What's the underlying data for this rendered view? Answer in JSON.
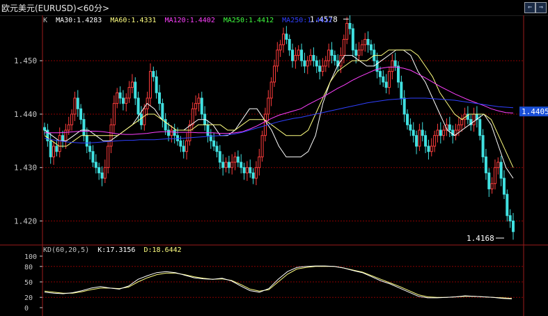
{
  "window": {
    "title": "欧元美元(EURUSD)<60分>",
    "nav": {
      "prev": "⇐",
      "next": "⇒"
    }
  },
  "main_panel": {
    "legend_prefix": "K",
    "ma": [
      {
        "label": "MA30:1.4283",
        "color": "#ffffff"
      },
      {
        "label": "MA60:1.4331",
        "color": "#ffff80"
      },
      {
        "label": "MA120:1.4402",
        "color": "#ff40ff"
      },
      {
        "label": "MA250:1.4412",
        "color": "#40ff40"
      },
      {
        "label": "MA250:1.4412",
        "color": "#3040ff"
      }
    ],
    "y_ticks": [
      "1.450",
      "1.440",
      "1.430",
      "1.420"
    ],
    "high_label": "1.4578",
    "low_label": "1.4168",
    "current_label": "1.4405"
  },
  "kd_panel": {
    "legend": "KD(60,20,5)",
    "k_label": "K:17.3156",
    "d_label": "D:18.6442",
    "y_ticks": [
      "100",
      "80",
      "50",
      "20",
      "0"
    ]
  },
  "colors": {
    "up": "#ff3c3c",
    "down": "#40e0e0",
    "grid": "#8b0000",
    "current_box": "#1a4fd6"
  },
  "chart_data": {
    "type": "candlestick",
    "ylim": [
      1.4155,
      1.4585
    ],
    "closes": [
      1.437,
      1.435,
      1.432,
      1.434,
      1.433,
      1.436,
      1.435,
      1.437,
      1.438,
      1.44,
      1.443,
      1.441,
      1.439,
      1.436,
      1.434,
      1.433,
      1.431,
      1.43,
      1.429,
      1.428,
      1.43,
      1.434,
      1.438,
      1.442,
      1.444,
      1.443,
      1.442,
      1.443,
      1.445,
      1.446,
      1.443,
      1.44,
      1.438,
      1.441,
      1.443,
      1.448,
      1.447,
      1.444,
      1.442,
      1.439,
      1.437,
      1.436,
      1.437,
      1.436,
      1.435,
      1.434,
      1.433,
      1.435,
      1.438,
      1.441,
      1.442,
      1.443,
      1.44,
      1.438,
      1.436,
      1.435,
      1.434,
      1.433,
      1.431,
      1.43,
      1.431,
      1.43,
      1.431,
      1.432,
      1.431,
      1.43,
      1.429,
      1.43,
      1.429,
      1.428,
      1.43,
      1.432,
      1.436,
      1.44,
      1.443,
      1.446,
      1.449,
      1.452,
      1.453,
      1.455,
      1.454,
      1.452,
      1.45,
      1.451,
      1.452,
      1.45,
      1.449,
      1.45,
      1.451,
      1.45,
      1.449,
      1.448,
      1.449,
      1.45,
      1.452,
      1.451,
      1.45,
      1.449,
      1.451,
      1.454,
      1.457,
      1.456,
      1.452,
      1.451,
      1.452,
      1.453,
      1.454,
      1.453,
      1.452,
      1.45,
      1.448,
      1.447,
      1.446,
      1.445,
      1.448,
      1.45,
      1.449,
      1.446,
      1.443,
      1.44,
      1.438,
      1.437,
      1.436,
      1.434,
      1.437,
      1.436,
      1.434,
      1.433,
      1.434,
      1.436,
      1.437,
      1.436,
      1.437,
      1.438,
      1.437,
      1.436,
      1.437,
      1.438,
      1.439,
      1.44,
      1.439,
      1.438,
      1.44,
      1.439,
      1.436,
      1.432,
      1.429,
      1.426,
      1.427,
      1.43,
      1.431,
      1.428,
      1.425,
      1.421,
      1.42,
      1.418
    ],
    "ma_series": [
      {
        "name": "MA30",
        "values": [
          1.437,
          1.436,
          1.435,
          1.435,
          1.436,
          1.437,
          1.437,
          1.436,
          1.435,
          1.435,
          1.436,
          1.437,
          1.438,
          1.44,
          1.442,
          1.441,
          1.439,
          1.438,
          1.437,
          1.437,
          1.438,
          1.439,
          1.439,
          1.438,
          1.436,
          1.436,
          1.437,
          1.439,
          1.441,
          1.441,
          1.439,
          1.437,
          1.434,
          1.432,
          1.432,
          1.432,
          1.433,
          1.436,
          1.442,
          1.446,
          1.449,
          1.451,
          1.451,
          1.45,
          1.449,
          1.449,
          1.45,
          1.451,
          1.452,
          1.452,
          1.451,
          1.448,
          1.446,
          1.443,
          1.44,
          1.437,
          1.436,
          1.437,
          1.438,
          1.439,
          1.44,
          1.438,
          1.434,
          1.43,
          1.428
        ]
      },
      {
        "name": "MA60",
        "values": [
          1.436,
          1.435,
          1.434,
          1.434,
          1.435,
          1.436,
          1.436,
          1.436,
          1.436,
          1.436,
          1.436,
          1.437,
          1.438,
          1.439,
          1.44,
          1.44,
          1.439,
          1.438,
          1.437,
          1.437,
          1.437,
          1.438,
          1.438,
          1.438,
          1.438,
          1.437,
          1.437,
          1.438,
          1.439,
          1.439,
          1.439,
          1.438,
          1.437,
          1.436,
          1.436,
          1.436,
          1.437,
          1.44,
          1.443,
          1.446,
          1.448,
          1.449,
          1.45,
          1.45,
          1.45,
          1.451,
          1.451,
          1.452,
          1.452,
          1.452,
          1.452,
          1.451,
          1.449,
          1.447,
          1.444,
          1.442,
          1.44,
          1.439,
          1.44,
          1.44,
          1.44,
          1.439,
          1.436,
          1.433,
          1.43
        ]
      },
      {
        "name": "MA120",
        "values": [
          1.4365,
          1.4365,
          1.4365,
          1.4366,
          1.4367,
          1.4368,
          1.4368,
          1.4368,
          1.4367,
          1.4365,
          1.4363,
          1.4362,
          1.4362,
          1.4363,
          1.4364,
          1.4366,
          1.4367,
          1.4367,
          1.4366,
          1.4366,
          1.4366,
          1.4365,
          1.4365,
          1.4365,
          1.4364,
          1.4364,
          1.4365,
          1.4367,
          1.4372,
          1.4378,
          1.4385,
          1.4392,
          1.4398,
          1.4402,
          1.4406,
          1.441,
          1.4418,
          1.4425,
          1.4432,
          1.444,
          1.4448,
          1.4455,
          1.4463,
          1.447,
          1.4476,
          1.4482,
          1.4486,
          1.4488,
          1.4488,
          1.4486,
          1.4482,
          1.4475,
          1.4468,
          1.446,
          1.4452,
          1.4445,
          1.4438,
          1.4432,
          1.4426,
          1.4421,
          1.4416,
          1.441,
          1.4406,
          1.4403,
          1.4402
        ]
      },
      {
        "name": "MA250",
        "values": [
          1.4355,
          1.4352,
          1.435,
          1.4348,
          1.4347,
          1.4346,
          1.4346,
          1.4347,
          1.4348,
          1.4349,
          1.435,
          1.4351,
          1.4351,
          1.4352,
          1.4352,
          1.4352,
          1.4353,
          1.4354,
          1.4354,
          1.4355,
          1.4356,
          1.4357,
          1.4358,
          1.4359,
          1.436,
          1.4361,
          1.4363,
          1.4366,
          1.437,
          1.4374,
          1.4378,
          1.4382,
          1.4386,
          1.4389,
          1.4392,
          1.4394,
          1.4397,
          1.44,
          1.4403,
          1.4406,
          1.4409,
          1.4412,
          1.4415,
          1.4418,
          1.4421,
          1.4423,
          1.4425,
          1.4427,
          1.4428,
          1.4429,
          1.443,
          1.443,
          1.443,
          1.4429,
          1.4428,
          1.4427,
          1.4426,
          1.4424,
          1.4422,
          1.442,
          1.4418,
          1.4416,
          1.4414,
          1.4413,
          1.4412
        ]
      }
    ],
    "kd": {
      "ylim": [
        0,
        100
      ],
      "k": [
        30,
        28,
        27,
        29,
        33,
        38,
        41,
        38,
        36,
        42,
        55,
        62,
        68,
        70,
        68,
        63,
        58,
        56,
        55,
        57,
        52,
        42,
        33,
        30,
        37,
        55,
        70,
        78,
        80,
        81,
        81,
        80,
        77,
        72,
        68,
        60,
        52,
        46,
        38,
        30,
        22,
        19,
        19,
        20,
        21,
        23,
        22,
        21,
        20,
        18,
        17
      ],
      "d": [
        32,
        30,
        28,
        28,
        31,
        35,
        38,
        38,
        37,
        40,
        50,
        58,
        64,
        67,
        67,
        64,
        60,
        57,
        55,
        56,
        53,
        45,
        36,
        32,
        35,
        50,
        65,
        75,
        78,
        80,
        80,
        80,
        77,
        73,
        69,
        62,
        55,
        48,
        41,
        33,
        25,
        21,
        20,
        20,
        21,
        22,
        22,
        21,
        20,
        19,
        18
      ]
    }
  }
}
